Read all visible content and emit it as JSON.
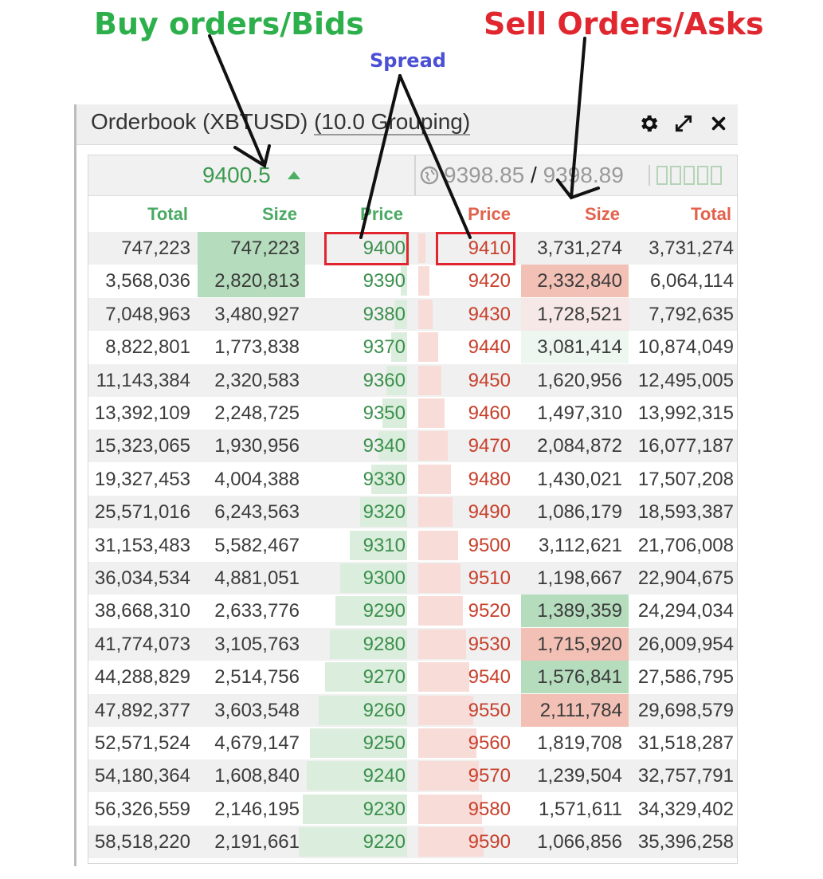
{
  "annotations": {
    "buy_label": "Buy orders/Bids",
    "sell_label": "Sell Orders/Asks",
    "spread_label": "Spread"
  },
  "widget": {
    "title_prefix": "Orderbook (XBTUSD) ",
    "title_grouping": "(10.0 Grouping)",
    "icons": [
      "gear-icon",
      "expand-icon",
      "close-icon"
    ]
  },
  "summary": {
    "last_price": "9400.5",
    "index_left": "9398.85",
    "separator": " / ",
    "index_right": "9398.89"
  },
  "headers": {
    "bid_total": "Total",
    "bid_size": "Size",
    "bid_price": "Price",
    "ask_price": "Price",
    "ask_size": "Size",
    "ask_total": "Total"
  },
  "colors": {
    "bid_text": "#3b8f4c",
    "ask_text": "#c8402c",
    "bid_flash": "#b5dcbd",
    "ask_flash": "#f2c0b5",
    "highlight_box": "#e0252f"
  },
  "rows": [
    {
      "bid_total": "747,223",
      "bid_size": "747,223",
      "bid_price": "9400",
      "ask_price": "9410",
      "ask_size": "3,731,274",
      "ask_total": "3,731,274",
      "bid_flash": "green",
      "ask_flash": ""
    },
    {
      "bid_total": "3,568,036",
      "bid_size": "2,820,813",
      "bid_price": "9390",
      "ask_price": "9420",
      "ask_size": "2,332,840",
      "ask_total": "6,064,114",
      "bid_flash": "green",
      "ask_flash": "red"
    },
    {
      "bid_total": "7,048,963",
      "bid_size": "3,480,927",
      "bid_price": "9380",
      "ask_price": "9430",
      "ask_size": "1,728,521",
      "ask_total": "7,792,635",
      "bid_flash": "",
      "ask_flash": "faint-red"
    },
    {
      "bid_total": "8,822,801",
      "bid_size": "1,773,838",
      "bid_price": "9370",
      "ask_price": "9440",
      "ask_size": "3,081,414",
      "ask_total": "10,874,049",
      "bid_flash": "",
      "ask_flash": "faint-green"
    },
    {
      "bid_total": "11,143,384",
      "bid_size": "2,320,583",
      "bid_price": "9360",
      "ask_price": "9450",
      "ask_size": "1,620,956",
      "ask_total": "12,495,005",
      "bid_flash": "",
      "ask_flash": ""
    },
    {
      "bid_total": "13,392,109",
      "bid_size": "2,248,725",
      "bid_price": "9350",
      "ask_price": "9460",
      "ask_size": "1,497,310",
      "ask_total": "13,992,315",
      "bid_flash": "",
      "ask_flash": ""
    },
    {
      "bid_total": "15,323,065",
      "bid_size": "1,930,956",
      "bid_price": "9340",
      "ask_price": "9470",
      "ask_size": "2,084,872",
      "ask_total": "16,077,187",
      "bid_flash": "",
      "ask_flash": ""
    },
    {
      "bid_total": "19,327,453",
      "bid_size": "4,004,388",
      "bid_price": "9330",
      "ask_price": "9480",
      "ask_size": "1,430,021",
      "ask_total": "17,507,208",
      "bid_flash": "",
      "ask_flash": ""
    },
    {
      "bid_total": "25,571,016",
      "bid_size": "6,243,563",
      "bid_price": "9320",
      "ask_price": "9490",
      "ask_size": "1,086,179",
      "ask_total": "18,593,387",
      "bid_flash": "",
      "ask_flash": ""
    },
    {
      "bid_total": "31,153,483",
      "bid_size": "5,582,467",
      "bid_price": "9310",
      "ask_price": "9500",
      "ask_size": "3,112,621",
      "ask_total": "21,706,008",
      "bid_flash": "",
      "ask_flash": ""
    },
    {
      "bid_total": "36,034,534",
      "bid_size": "4,881,051",
      "bid_price": "9300",
      "ask_price": "9510",
      "ask_size": "1,198,667",
      "ask_total": "22,904,675",
      "bid_flash": "",
      "ask_flash": ""
    },
    {
      "bid_total": "38,668,310",
      "bid_size": "2,633,776",
      "bid_price": "9290",
      "ask_price": "9520",
      "ask_size": "1,389,359",
      "ask_total": "24,294,034",
      "bid_flash": "",
      "ask_flash": "green"
    },
    {
      "bid_total": "41,774,073",
      "bid_size": "3,105,763",
      "bid_price": "9280",
      "ask_price": "9530",
      "ask_size": "1,715,920",
      "ask_total": "26,009,954",
      "bid_flash": "",
      "ask_flash": "red"
    },
    {
      "bid_total": "44,288,829",
      "bid_size": "2,514,756",
      "bid_price": "9270",
      "ask_price": "9540",
      "ask_size": "1,576,841",
      "ask_total": "27,586,795",
      "bid_flash": "",
      "ask_flash": "green"
    },
    {
      "bid_total": "47,892,377",
      "bid_size": "3,603,548",
      "bid_price": "9260",
      "ask_price": "9550",
      "ask_size": "2,111,784",
      "ask_total": "29,698,579",
      "bid_flash": "",
      "ask_flash": "red"
    },
    {
      "bid_total": "52,571,524",
      "bid_size": "4,679,147",
      "bid_price": "9250",
      "ask_price": "9560",
      "ask_size": "1,819,708",
      "ask_total": "31,518,287",
      "bid_flash": "",
      "ask_flash": ""
    },
    {
      "bid_total": "54,180,364",
      "bid_size": "1,608,840",
      "bid_price": "9240",
      "ask_price": "9570",
      "ask_size": "1,239,504",
      "ask_total": "32,757,791",
      "bid_flash": "",
      "ask_flash": ""
    },
    {
      "bid_total": "56,326,559",
      "bid_size": "2,146,195",
      "bid_price": "9230",
      "ask_price": "9580",
      "ask_size": "1,571,611",
      "ask_total": "34,329,402",
      "bid_flash": "",
      "ask_flash": ""
    },
    {
      "bid_total": "58,518,220",
      "bid_size": "2,191,661",
      "bid_price": "9220",
      "ask_price": "9590",
      "ask_size": "1,066,856",
      "ask_total": "35,396,258",
      "bid_flash": "",
      "ask_flash": ""
    }
  ]
}
